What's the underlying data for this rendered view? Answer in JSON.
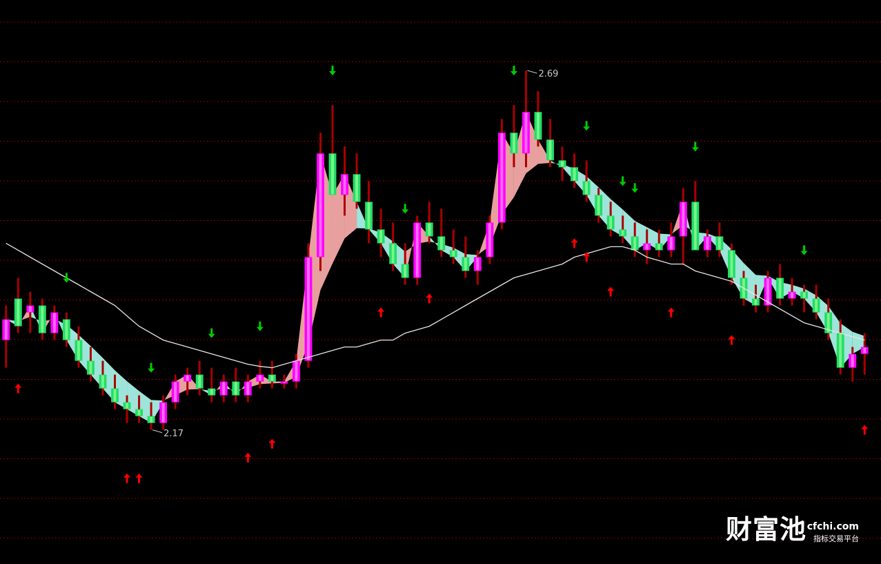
{
  "chart_data": {
    "type": "candlestick",
    "title": "",
    "ylim": [
      1.98,
      2.79
    ],
    "grid": true,
    "high_label": "2.69",
    "low_label": "2.17",
    "ohlc": [
      [
        2.3,
        2.35,
        2.26,
        2.33
      ],
      [
        2.36,
        2.39,
        2.31,
        2.32
      ],
      [
        2.34,
        2.37,
        2.31,
        2.35
      ],
      [
        2.35,
        2.36,
        2.3,
        2.31
      ],
      [
        2.31,
        2.35,
        2.3,
        2.34
      ],
      [
        2.33,
        2.34,
        2.29,
        2.3
      ],
      [
        2.3,
        2.32,
        2.26,
        2.27
      ],
      [
        2.27,
        2.29,
        2.24,
        2.25
      ],
      [
        2.25,
        2.27,
        2.22,
        2.23
      ],
      [
        2.23,
        2.25,
        2.2,
        2.21
      ],
      [
        2.21,
        2.22,
        2.18,
        2.2
      ],
      [
        2.2,
        2.22,
        2.18,
        2.19
      ],
      [
        2.19,
        2.21,
        2.17,
        2.18
      ],
      [
        2.18,
        2.22,
        2.17,
        2.21
      ],
      [
        2.21,
        2.25,
        2.2,
        2.24
      ],
      [
        2.24,
        2.26,
        2.22,
        2.25
      ],
      [
        2.25,
        2.27,
        2.22,
        2.23
      ],
      [
        2.23,
        2.26,
        2.21,
        2.22
      ],
      [
        2.22,
        2.25,
        2.21,
        2.24
      ],
      [
        2.24,
        2.26,
        2.21,
        2.22
      ],
      [
        2.22,
        2.25,
        2.21,
        2.24
      ],
      [
        2.24,
        2.27,
        2.23,
        2.25
      ],
      [
        2.25,
        2.27,
        2.23,
        2.24
      ],
      [
        2.24,
        2.25,
        2.23,
        2.24
      ],
      [
        2.24,
        2.28,
        2.23,
        2.27
      ],
      [
        2.27,
        2.44,
        2.26,
        2.42
      ],
      [
        2.42,
        2.6,
        2.4,
        2.57
      ],
      [
        2.57,
        2.64,
        2.54,
        2.51
      ],
      [
        2.51,
        2.58,
        2.48,
        2.54
      ],
      [
        2.54,
        2.57,
        2.49,
        2.5
      ],
      [
        2.5,
        2.53,
        2.44,
        2.46
      ],
      [
        2.46,
        2.49,
        2.42,
        2.44
      ],
      [
        2.44,
        2.47,
        2.4,
        2.41
      ],
      [
        2.41,
        2.44,
        2.38,
        2.39
      ],
      [
        2.39,
        2.48,
        2.38,
        2.47
      ],
      [
        2.47,
        2.5,
        2.44,
        2.45
      ],
      [
        2.45,
        2.49,
        2.42,
        2.43
      ],
      [
        2.43,
        2.46,
        2.41,
        2.42
      ],
      [
        2.42,
        2.45,
        2.39,
        2.4
      ],
      [
        2.4,
        2.43,
        2.38,
        2.42
      ],
      [
        2.42,
        2.48,
        2.41,
        2.47
      ],
      [
        2.47,
        2.62,
        2.46,
        2.6
      ],
      [
        2.6,
        2.64,
        2.55,
        2.57
      ],
      [
        2.57,
        2.69,
        2.55,
        2.63
      ],
      [
        2.63,
        2.66,
        2.58,
        2.59
      ],
      [
        2.59,
        2.62,
        2.55,
        2.56
      ],
      [
        2.56,
        2.58,
        2.53,
        2.55
      ],
      [
        2.55,
        2.57,
        2.52,
        2.53
      ],
      [
        2.53,
        2.56,
        2.5,
        2.51
      ],
      [
        2.51,
        2.52,
        2.47,
        2.48
      ],
      [
        2.48,
        2.5,
        2.45,
        2.46
      ],
      [
        2.46,
        2.48,
        2.44,
        2.45
      ],
      [
        2.45,
        2.47,
        2.42,
        2.43
      ],
      [
        2.43,
        2.46,
        2.41,
        2.44
      ],
      [
        2.44,
        2.46,
        2.42,
        2.43
      ],
      [
        2.43,
        2.47,
        2.42,
        2.45
      ],
      [
        2.45,
        2.52,
        2.41,
        2.5
      ],
      [
        2.5,
        2.53,
        2.43,
        2.43
      ],
      [
        2.43,
        2.46,
        2.42,
        2.45
      ],
      [
        2.45,
        2.47,
        2.42,
        2.43
      ],
      [
        2.43,
        2.44,
        2.38,
        2.39
      ],
      [
        2.39,
        2.4,
        2.35,
        2.36
      ],
      [
        2.36,
        2.38,
        2.34,
        2.35
      ],
      [
        2.35,
        2.4,
        2.34,
        2.39
      ],
      [
        2.39,
        2.41,
        2.35,
        2.36
      ],
      [
        2.36,
        2.39,
        2.35,
        2.37
      ],
      [
        2.37,
        2.38,
        2.34,
        2.36
      ],
      [
        2.36,
        2.38,
        2.33,
        2.34
      ],
      [
        2.34,
        2.36,
        2.3,
        2.31
      ],
      [
        2.31,
        2.33,
        2.25,
        2.26
      ],
      [
        2.26,
        2.29,
        2.24,
        2.28
      ],
      [
        2.28,
        2.31,
        2.25,
        2.29
      ]
    ],
    "ma_levels": [
      2.44,
      2.43,
      2.42,
      2.41,
      2.4,
      2.39,
      2.38,
      2.37,
      2.36,
      2.35,
      2.335,
      2.32,
      2.31,
      2.3,
      2.295,
      2.29,
      2.285,
      2.28,
      2.275,
      2.27,
      2.265,
      2.262,
      2.26,
      2.265,
      2.27,
      2.275,
      2.28,
      2.285,
      2.29,
      2.29,
      2.295,
      2.3,
      2.3,
      2.31,
      2.315,
      2.32,
      2.33,
      2.34,
      2.35,
      2.36,
      2.37,
      2.38,
      2.39,
      2.395,
      2.4,
      2.405,
      2.41,
      2.42,
      2.425,
      2.43,
      2.435,
      2.435,
      2.43,
      2.42,
      2.415,
      2.41,
      2.41,
      2.4,
      2.395,
      2.39,
      2.385,
      2.375,
      2.365,
      2.355,
      2.345,
      2.335,
      2.325,
      2.32,
      2.315,
      2.31,
      2.305,
      2.3
    ],
    "buy_arrow_bars": [
      1,
      10,
      11,
      20,
      22,
      31,
      35,
      47,
      48,
      50,
      55,
      60,
      71
    ],
    "sell_arrow_bars": [
      5,
      12,
      17,
      21,
      27,
      33,
      42,
      48,
      51,
      52,
      57,
      66
    ]
  },
  "watermark": {
    "name": "财富池",
    "url": "cfchi.com",
    "tagline": "指标交易平台"
  },
  "colors": {
    "up_body": "#ff00ff",
    "up_inner": "#ff99ff",
    "down_body": "#22dd66",
    "down_inner": "#99ff99",
    "wick": "#aa0000",
    "ribbon_up": "#f4a9a8",
    "ribbon_down": "#a8f0e6",
    "ma_line": "#e6e6e6",
    "grid": "#8a0000",
    "buy_arrow": "#ff0000",
    "sell_arrow": "#00cc00"
  }
}
